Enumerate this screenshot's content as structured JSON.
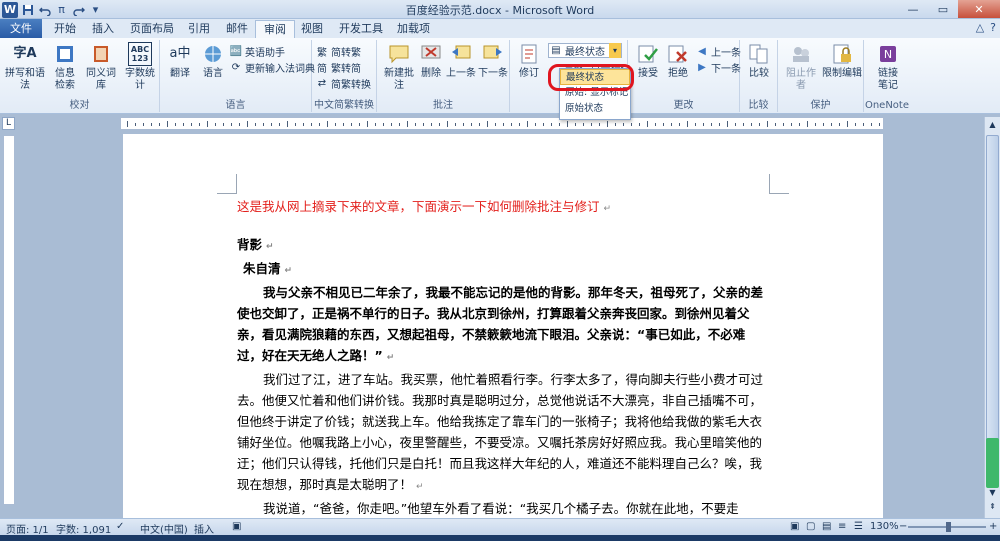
{
  "window": {
    "title": "百度经验示范.docx - Microsoft Word"
  },
  "qat": {
    "logo": "W",
    "save_icon": "save-icon",
    "undo_icon": "undo-icon",
    "pi_label": "π",
    "redo_icon": "redo-icon"
  },
  "tabs": [
    {
      "label": "文件"
    },
    {
      "label": "开始"
    },
    {
      "label": "插入"
    },
    {
      "label": "页面布局"
    },
    {
      "label": "引用"
    },
    {
      "label": "邮件"
    },
    {
      "label": "审阅"
    },
    {
      "label": "视图"
    },
    {
      "label": "开发工具"
    },
    {
      "label": "加载项"
    }
  ],
  "ribbon": {
    "groups": {
      "proofing": {
        "label": "校对",
        "spelling": "拼写和语法",
        "research": "信息\n检索",
        "thesaurus": "同义词库",
        "wordcount": "字数统计",
        "wordcount_icon_text": "ABC\n123"
      },
      "language": {
        "label": "语言",
        "translate": "翻译",
        "language": "语言",
        "english_assistant": "英语助手",
        "update_ime": "更新输入法词典"
      },
      "chinese": {
        "label": "中文简繁转换",
        "to_traditional": "简转繁",
        "to_simplified": "繁转简",
        "convert": "简繁转换"
      },
      "comments": {
        "label": "批注",
        "new": "新建批注",
        "delete": "删除",
        "previous": "上一条",
        "next": "下一条"
      },
      "tracking": {
        "revise": "修订",
        "display_value": "最终状态",
        "show_markup_truncated": "最终: 显示标记"
      },
      "changes": {
        "label": "更改",
        "accept": "接受",
        "reject": "拒绝",
        "previous": "上一条",
        "next": "下一条"
      },
      "compare": {
        "label": "比较",
        "compare": "比较"
      },
      "protect": {
        "label": "保护",
        "block_authors": "阻止作者",
        "restrict_editing": "限制编辑"
      },
      "onenote": {
        "label": "OneNote",
        "linked_notes": "链接\n笔记"
      }
    }
  },
  "dropdown": {
    "items": [
      {
        "label": "最终状态"
      },
      {
        "label": "原始: 显示标记"
      },
      {
        "label": "原始状态"
      }
    ]
  },
  "document": {
    "paragraphs": [
      {
        "text": "这是我从网上摘录下来的文章，下面演示一下如何删除批注与修订",
        "style": "red"
      },
      {
        "text": "背影",
        "style": "bold"
      },
      {
        "text": "朱自清",
        "style": "bold"
      },
      {
        "text": "我与父亲不相见已二年余了，我最不能忘记的是他的背影。那年冬天，祖母死了，父亲的差使也交卸了，正是祸不单行的日子。我从北京到徐州，打算跟着父亲奔丧回家。到徐州见着父亲，看见满院狼藉的东西，又想起祖母，不禁簌簌地流下眼泪。父亲说：“事已如此，不必难过，好在天无绝人之路！”",
        "style": "bold-indent"
      },
      {
        "text": "我们过了江，进了车站。我买票，他忙着照看行李。行李太多了，得向脚夫行些小费才可过去。他便又忙着和他们讲价钱。我那时真是聪明过分，总觉他说话不大漂亮，非自己插嘴不可，但他终于讲定了价钱；就送我上车。他给我拣定了靠车门的一张椅子；我将他给我做的紫毛大衣铺好坐位。他嘱我路上小心，夜里警醒些，不要受凉。又嘱托茶房好好照应我。我心里暗笑他的迂；他们只认得钱，托他们只是白托！而且我这样大年纪的人，难道还不能料理自己么？唉，我现在想想，那时真是太聪明了！",
        "style": "indent"
      },
      {
        "text": "我说道，“爸爸，你走吧。”他望车外看了看说：“我买几个橘子去。你就在此地，不要走动。”我看那边月台的栅栏外有几个卖东西的等着顾客。走到那边月台，须穿过铁道，须跳下去又爬上去。父亲是一个胖子，走过去自然要费事些。",
        "style": "indent"
      }
    ]
  },
  "statusbar": {
    "page": "页面: 1/1",
    "words": "字数: 1,091",
    "language": "中文(中国)",
    "mode": "插入",
    "zoom": "130%",
    "zoom_minus": "−",
    "zoom_plus": "+"
  },
  "colors": {
    "accent": "#2b5797",
    "revision_red": "#e3201c",
    "highlight_oval": "#e0151f",
    "selected_item": "#fde49a"
  }
}
